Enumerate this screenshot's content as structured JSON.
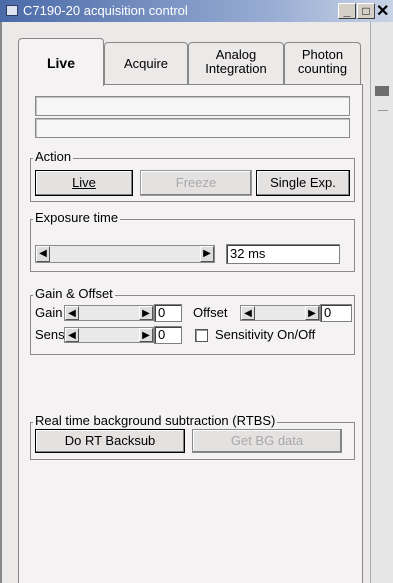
{
  "window": {
    "title": "C7190-20 acquisition control"
  },
  "tabs": [
    {
      "label": "Live",
      "active": true
    },
    {
      "label": "Acquire"
    },
    {
      "label": "Analog Integration"
    },
    {
      "label": "Photon counting"
    }
  ],
  "action": {
    "label": "Action",
    "live_button": "Live",
    "freeze_button": "Freeze",
    "single_button": "Single Exp."
  },
  "exposure": {
    "label": "Exposure time",
    "value": "32 ms"
  },
  "gain_offset": {
    "label": "Gain & Offset",
    "gain_label": "Gain",
    "gain_value": "0",
    "offset_label": "Offset",
    "offset_value": "0",
    "sens_label": "Sens.",
    "sens_value": "0",
    "sensitivity_checkbox_label": "Sensitivity On/Off",
    "sensitivity_checked": false
  },
  "rtbs": {
    "label": "Real time background subtraction (RTBS)",
    "backsub_button": "Do RT Backsub",
    "bgdata_button": "Get BG data"
  },
  "colors": {
    "titlebar_start": "#4a6aa8",
    "disabled_text": "#a8a8a8"
  }
}
